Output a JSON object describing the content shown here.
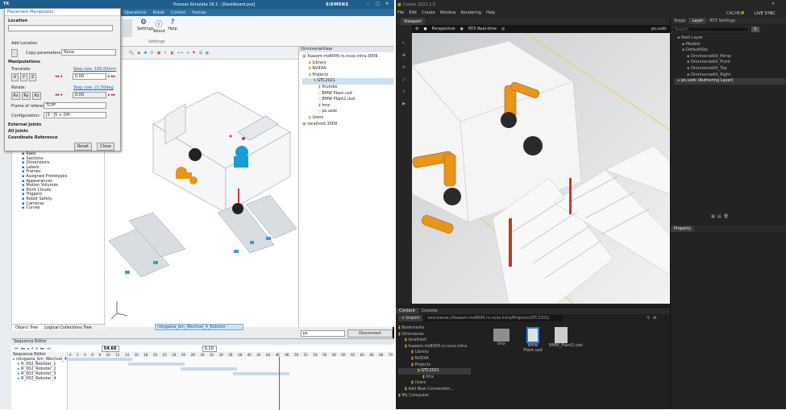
{
  "left_app": {
    "title": "Process Simulate 16.1 - [Dashboard.psz]",
    "brand": "SIEMENS",
    "ribbon_tabs": [
      "Operations",
      "Robot",
      "Control",
      "Human"
    ],
    "ribbon_buttons": [
      "Settings",
      "About",
      "Help"
    ],
    "ribbon_group_label": "Settings",
    "dialog": {
      "title": "Placement Manipulator",
      "sections": {
        "location": "Location",
        "manipulations": "Manipulations",
        "external_joints": "External Joints",
        "all_joints": "All Joints",
        "coordinate_reference": "Coordinate Reference"
      },
      "add_location": "Add Location",
      "copy_parameters_label": "Copy parameters",
      "copy_parameters_value": "None",
      "translate_label": "Translate:",
      "rotate_label": "Rotate:",
      "axes_translate": [
        "X",
        "Y",
        "Z"
      ],
      "axes_rotate": [
        "Rx",
        "Ry",
        "Rz"
      ],
      "translate_step": "Step size: 100.00mm",
      "rotate_step": "Step size: 22.50deg",
      "translate_value": "0.00",
      "rotate_value": "0.00",
      "frame_label": "Frame of reference:",
      "frame_value": "TCPF",
      "config_label": "Configuration:",
      "config_value": "J3 - J5 + OH-",
      "reset": "Reset",
      "close": "Close"
    },
    "object_tree": {
      "items": [
        "Rails",
        "Sections",
        "Dimensions",
        "Labels",
        "Frames",
        "Assigned Prototypes",
        "Appearances",
        "Motion Volumes",
        "Point Clouds",
        "Triggers",
        "Robot Safety",
        "Cameras",
        "Curves"
      ],
      "tabs": [
        "Object Tree",
        "Logical Collections Tree"
      ]
    },
    "omniverse_view": {
      "title": "OmniverseView",
      "items": [
        "fsaaom-rtx8000.rs.nvxz.intra:3009",
        "Library",
        "NVIDIA",
        "Projects",
        "GTC2021",
        "thumbs",
        "BMW Plant.usd",
        "BMW Plant2.usd",
        "tmx",
        "ps.usdc",
        "Users",
        "localhost:3009"
      ],
      "bottom_field": "ps",
      "disconnect": "Disconnect"
    },
    "viewport_caption": "rotsgasta_bm_Wechsel_4_Roboter",
    "sequence_editor": {
      "title": "Sequence Editor",
      "time_value": "54.66",
      "speed_value": "0.10",
      "tree_header": "Sequence Editor",
      "rows": [
        "rotsgasta_bm_Wechsel_4",
        "R_002_Roboter_1",
        "R_002_Roboter_2",
        "R_002_Roboter_3",
        "R_002_Roboter_4"
      ],
      "ruler": [
        "0",
        "2",
        "4",
        "6",
        "8",
        "10",
        "12",
        "14",
        "16",
        "18",
        "20",
        "22",
        "24",
        "26",
        "28",
        "30",
        "32",
        "34",
        "36",
        "38",
        "40",
        "42",
        "44",
        "46",
        "48",
        "50",
        "52",
        "54",
        "56",
        "58",
        "60",
        "62",
        "64",
        "66",
        "68",
        "70"
      ]
    }
  },
  "right_app": {
    "title": "Create 2021.1.0",
    "menu": [
      "File",
      "Edit",
      "Create",
      "Window",
      "Rendering",
      "Help"
    ],
    "cache": "CACHE:",
    "live_sync": "LIVE SYNC",
    "viewport_tab": "Viewport",
    "perspective": "Perspective",
    "rtx": "RTX Real-time",
    "camera_name": "ps.usdc",
    "stage": {
      "tabs": [
        "Stage",
        "Layer",
        "RTX Settings"
      ],
      "search_placeholder": "Search",
      "items": [
        "Root Layer",
        "Models",
        "DefaultSky",
        "OmniverseKit_Persp",
        "OmniverseKit_Front",
        "OmniverseKit_Top",
        "OmniverseKit_Right",
        "ps.usdc (Authoring Layer)"
      ]
    },
    "property_tab": "Property",
    "content": {
      "tabs": [
        "Content",
        "Console"
      ],
      "import": "+ Import",
      "path": "omniverse://fsaaom-rtx8000.rs.nvxz.intra/Projects/GTC2021/",
      "tree": [
        "Bookmarks",
        "Omniverse",
        "localhost",
        "fsaaom-rtx8000.rs.nvxz.intra",
        "Library",
        "NVIDIA",
        "Projects",
        "GTC2021",
        "tmx",
        "Users",
        "Add New Connection...",
        "My Computer"
      ],
      "files": [
        "tmx",
        "BMW Plant.usd",
        "BMW_Plant2.usd"
      ]
    }
  },
  "colors": {
    "ps_title": "#1f5e8a",
    "ov_bg": "#1f1f1f",
    "ov_accent": "#76b900",
    "robot_orange": "#e8951c"
  }
}
